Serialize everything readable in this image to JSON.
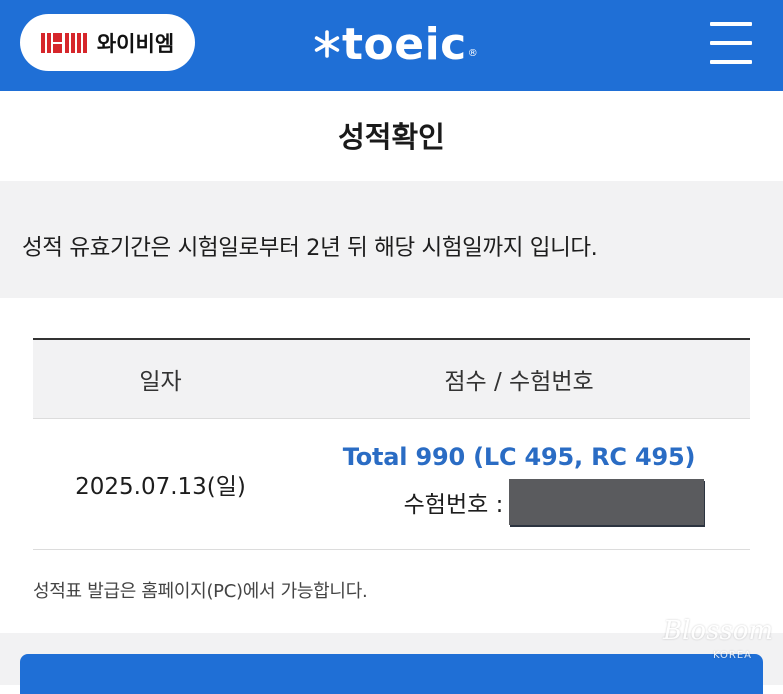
{
  "header": {
    "brand_label": "와이비엠",
    "logo_text": "toeic",
    "logo_symbol": "®",
    "menu_icon": "hamburger-menu-icon",
    "bg_color": "#1f6fd6"
  },
  "page": {
    "title": "성적확인",
    "notice": "성적 유효기간은 시험일로부터 2년 뒤 해당 시험일까지 입니다."
  },
  "table": {
    "headers": [
      "일자",
      "점수 / 수험번호"
    ],
    "rows": [
      {
        "date": "2025.07.13(일)",
        "score": "Total 990 (LC 495, RC 495)",
        "exam_label": "수험번호 :"
      }
    ]
  },
  "footnote": "성적표 발급은 홈페이지(PC)에서 가능합니다.",
  "watermark": {
    "script": "Blossom",
    "sub": "KOREA"
  },
  "colors": {
    "accent": "#1f6fd6",
    "score_text": "#2a6cc4",
    "band": "#f2f2f3"
  }
}
